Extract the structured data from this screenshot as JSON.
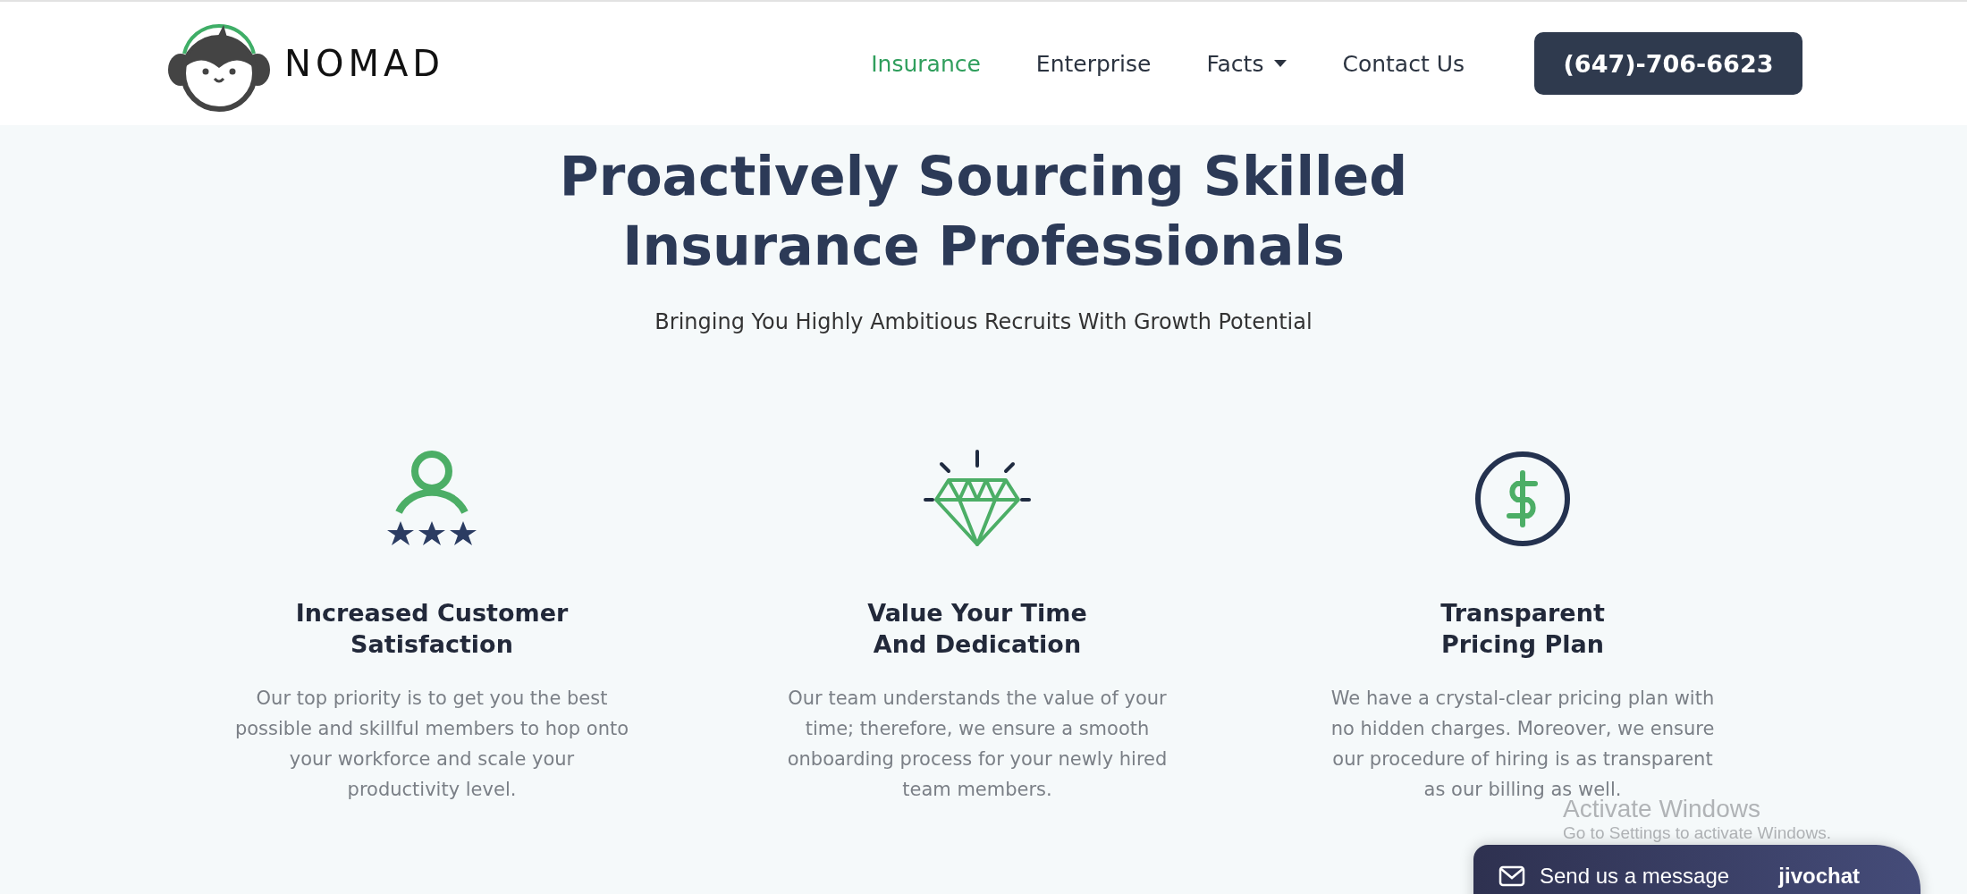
{
  "header": {
    "brand": "NOMAD",
    "nav": [
      {
        "label": "Insurance",
        "selected": true,
        "dropdown": false
      },
      {
        "label": "Enterprise",
        "selected": false,
        "dropdown": false
      },
      {
        "label": "Facts",
        "selected": false,
        "dropdown": true
      },
      {
        "label": "Contact Us",
        "selected": false,
        "dropdown": false
      }
    ],
    "phone_button": "(647)-706-6623"
  },
  "hero": {
    "title_lines": [
      "Proactively Sourcing Skilled",
      "Insurance Professionals"
    ],
    "subtitle": "Bringing You Highly Ambitious Recruits With Growth Potential"
  },
  "features": [
    {
      "kind": "rated-person",
      "title_lines": [
        "Increased Customer",
        "Satisfaction"
      ],
      "text_lines": [
        "Our top priority is to get you the best",
        "possible and skillful members to hop onto",
        "your workforce and scale your",
        "productivity level."
      ]
    },
    {
      "kind": "diamond",
      "title_lines": [
        "Value Your Time",
        "And Dedication"
      ],
      "text_lines": [
        "Our team understands the value of your",
        "time; therefore, we ensure a smooth",
        "onboarding process for your newly hired",
        "team members."
      ]
    },
    {
      "kind": "dollar",
      "title_lines": [
        "Transparent",
        "Pricing Plan"
      ],
      "text_lines": [
        "We have a crystal-clear pricing plan with",
        "no hidden charges. Moreover, we ensure",
        "our procedure of hiring is as transparent",
        "as our billing as well."
      ]
    }
  ],
  "os_notice": {
    "title": "Activate Windows",
    "text": "Go to Settings to activate Windows."
  },
  "chat_widget": {
    "label": "Send us a message",
    "brand": "jivochat"
  }
}
